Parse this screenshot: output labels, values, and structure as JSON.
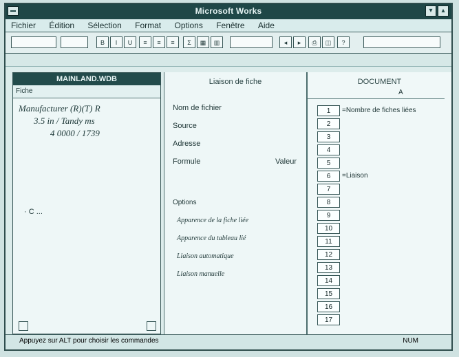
{
  "app": {
    "title": "Microsoft Works"
  },
  "menubar": {
    "items": [
      "Fichier",
      "Édition",
      "Sélection",
      "Format",
      "Options",
      "Fenêtre",
      "Aide"
    ]
  },
  "left_panel": {
    "title": "MAINLAND.WDB",
    "line1": "Manufacturer (R)(T) R",
    "line2": "3.5 in / Tandy ms",
    "line3": "4 0000 / 1739",
    "footer": "· C ...",
    "subbar": "Fiche"
  },
  "dialog": {
    "title": "Liaison de fiche",
    "fields": [
      {
        "label": "Nom de fichier",
        "value": ""
      },
      {
        "label": "Source",
        "value": ""
      },
      {
        "label": "Adresse",
        "value": ""
      },
      {
        "label": "Formule",
        "value": "Valeur"
      }
    ],
    "options_heading": "Options",
    "options": [
      "Apparence de la fiche liée",
      "Apparence du tableau lié",
      "Liaison automatique",
      "Liaison manuelle"
    ]
  },
  "grid": {
    "title": "DOCUMENT",
    "column_header": "A",
    "row_labels": [
      "1",
      "2",
      "3",
      "4",
      "5",
      "6",
      "7",
      "8",
      "9",
      "10",
      "11",
      "12",
      "13",
      "14",
      "15",
      "16",
      "17"
    ],
    "cells": [
      "=Nombre de fiches liées",
      "",
      "",
      "",
      "",
      "=Liaison",
      "",
      "",
      "",
      "",
      "",
      "",
      "",
      "",
      "",
      "",
      ""
    ]
  },
  "statusbar": {
    "left_text": "Appuyez sur ALT pour choisir les commandes",
    "right_text": "NUM"
  },
  "colors": {
    "titlebar": "#1f4747",
    "frame": "#2f4d4d",
    "background": "#cfe2e1"
  }
}
